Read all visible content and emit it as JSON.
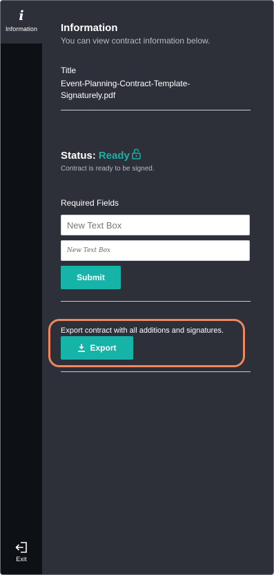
{
  "sidebar": {
    "info_glyph": "i",
    "info_label": "Information",
    "exit_label": "Exit"
  },
  "panel": {
    "title": "Information",
    "subtitle": "You can view contract information below.",
    "title_field_label": "Title",
    "title_field_value": "Event-Planning-Contract-Template-Signaturely.pdf",
    "status_label": "Status:",
    "status_value": "Ready",
    "status_note": "Contract is ready to be signed.",
    "required_fields_label": "Required Fields",
    "required_fields": [
      {
        "placeholder": "New Text Box"
      },
      {
        "placeholder": "New Text Box"
      }
    ],
    "submit_label": "Submit",
    "export_note": "Export contract with all additions and signatures.",
    "export_label": "Export"
  },
  "colors": {
    "accent": "#16b3a8",
    "panel_bg": "#2d3038",
    "rail_bg": "#0d1014",
    "highlight": "#f0875e"
  },
  "icons": {
    "info": "info-icon",
    "lock": "lock-open-icon",
    "download": "download-icon",
    "exit": "exit-icon"
  }
}
